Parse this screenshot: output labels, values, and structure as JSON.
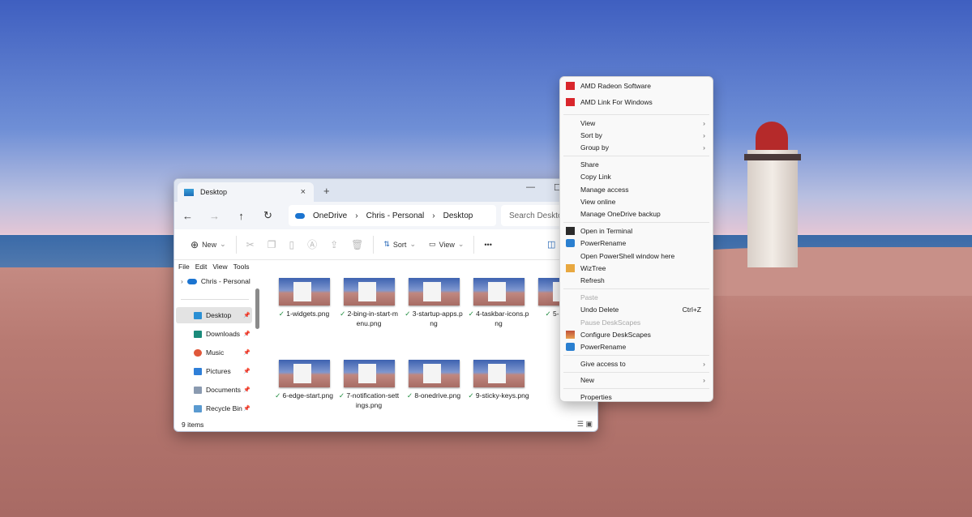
{
  "explorer": {
    "tab_title": "Desktop",
    "tab_close": "×",
    "new_tab": "+",
    "window_controls": [
      "—",
      "☐"
    ],
    "nav": {
      "back": "←",
      "forward": "→",
      "up": "↑",
      "refresh": "↻"
    },
    "breadcrumb": [
      "OneDrive",
      "Chris - Personal",
      "Desktop"
    ],
    "breadcrumb_sep": "›",
    "search_placeholder": "Search Desktop",
    "toolbar": {
      "new": "New",
      "sort": "Sort",
      "view": "View",
      "more": "•••"
    },
    "menubar": [
      "File",
      "Edit",
      "View",
      "Tools"
    ],
    "sidebar": {
      "root": "Chris - Personal",
      "items": [
        {
          "label": "Desktop",
          "color": "#2a8fd4",
          "selected": true
        },
        {
          "label": "Downloads",
          "color": "#1a8a7a"
        },
        {
          "label": "Music",
          "color": "#e0583a"
        },
        {
          "label": "Pictures",
          "color": "#2f7fd8"
        },
        {
          "label": "Documents",
          "color": "#8a9ab0"
        },
        {
          "label": "Recycle Bin",
          "color": "#5a9ad0"
        }
      ]
    },
    "files": [
      "1-widgets.png",
      "2-bing-in-start-menu.png",
      "3-startup-apps.png",
      "4-taskbar-icons.png",
      "5-sta png",
      "6-edge-start.png",
      "7-notification-settings.png",
      "8-onedrive.png",
      "9-sticky-keys.png"
    ],
    "status": "9 items"
  },
  "context_menu": {
    "items": [
      {
        "label": "AMD Radeon Software",
        "icon": "amd-icon"
      },
      {
        "label": "AMD Link For Windows",
        "icon": "amd-icon"
      },
      {
        "sep": true
      },
      {
        "label": "View",
        "submenu": true
      },
      {
        "label": "Sort by",
        "submenu": true
      },
      {
        "label": "Group by",
        "submenu": true
      },
      {
        "sep": true
      },
      {
        "label": "Share"
      },
      {
        "label": "Copy Link"
      },
      {
        "label": "Manage access"
      },
      {
        "label": "View online"
      },
      {
        "label": "Manage OneDrive backup"
      },
      {
        "sep": true
      },
      {
        "label": "Open in Terminal",
        "icon": "terminal-icon"
      },
      {
        "label": "PowerRename",
        "icon": "powerrename-icon"
      },
      {
        "label": "Open PowerShell window here"
      },
      {
        "label": "WizTree",
        "icon": "wiztree-icon"
      },
      {
        "label": "Refresh"
      },
      {
        "sep": true
      },
      {
        "label": "Paste",
        "disabled": true
      },
      {
        "label": "Undo Delete",
        "shortcut": "Ctrl+Z"
      },
      {
        "label": "Pause DeskScapes",
        "disabled": true
      },
      {
        "label": "Configure DeskScapes",
        "icon": "deskscapes-icon"
      },
      {
        "label": "PowerRename",
        "icon": "powerrename-icon"
      },
      {
        "sep": true
      },
      {
        "label": "Give access to",
        "submenu": true
      },
      {
        "sep": true
      },
      {
        "label": "New",
        "submenu": true
      },
      {
        "sep": true
      },
      {
        "label": "Properties"
      }
    ]
  }
}
